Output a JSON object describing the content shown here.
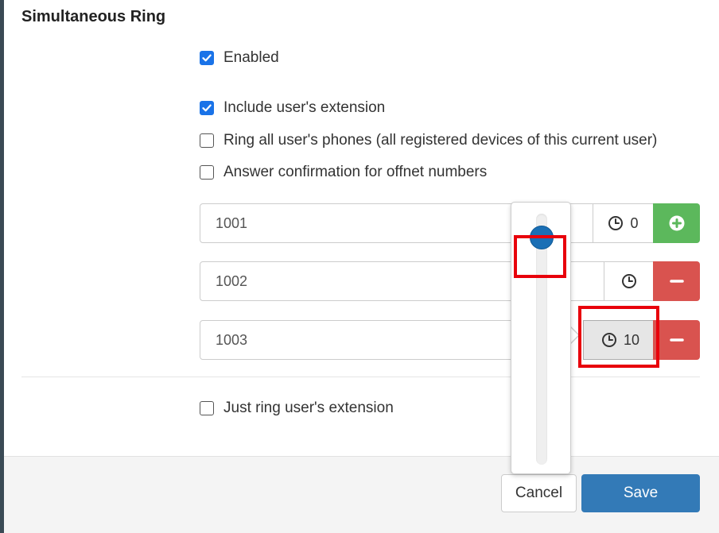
{
  "dialog": {
    "title": "Simultaneous Ring"
  },
  "options": {
    "enabled": {
      "label": "Enabled",
      "checked": true
    },
    "include_extension": {
      "label": "Include user's extension",
      "checked": true
    },
    "ring_all_phones": {
      "label": "Ring all user's phones (all registered devices of this current user)",
      "checked": false
    },
    "answer_confirmation": {
      "label": "Answer confirmation for offnet numbers",
      "checked": false
    },
    "just_ring_extension": {
      "label": "Just ring user's extension",
      "checked": false
    }
  },
  "numbers": [
    {
      "value": "1001",
      "delay": "0",
      "action": "add"
    },
    {
      "value": "1002",
      "delay": "",
      "action": "remove"
    },
    {
      "value": "1003",
      "delay": "10",
      "action": "remove"
    }
  ],
  "delay_slider": {
    "level": 0.05
  },
  "footer": {
    "cancel_label": "Cancel",
    "save_label": "Save"
  },
  "colors": {
    "checkbox_checked": "#1a73e8",
    "add_button": "#5cb85c",
    "remove_button": "#d9534f",
    "save_button": "#337ab7",
    "slider_thumb": "#1a6fb5",
    "highlight": "#e8000b"
  },
  "icons": {
    "timer": "clock-icon",
    "add": "plus-circle-icon",
    "remove": "minus-icon",
    "checkbox": "checkmark-icon"
  }
}
